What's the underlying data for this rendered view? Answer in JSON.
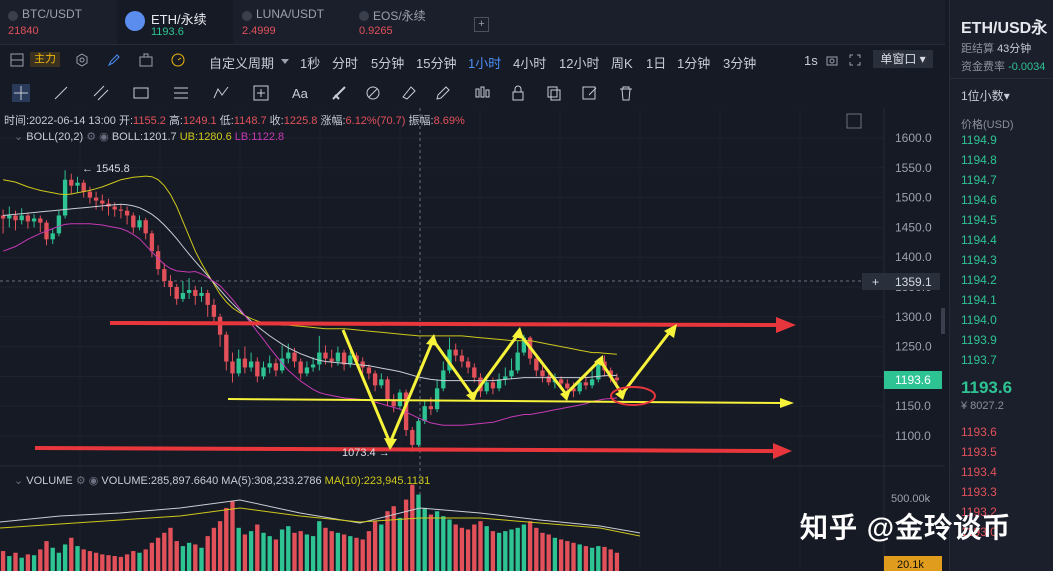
{
  "tabs": [
    {
      "name": "BTC/USDT",
      "price": "21840",
      "active": false
    },
    {
      "name": "ETH/永续",
      "price": "1193.6",
      "active": true
    },
    {
      "name": "LUNA/USDT",
      "price": "2.4999",
      "active": false
    },
    {
      "name": "EOS/永续",
      "price": "0.9265",
      "active": false
    }
  ],
  "add_tab": "+",
  "toolbar": {
    "main_label": "主力",
    "custom_period": "自定义周期",
    "periods": [
      "1秒",
      "分时",
      "5分钟",
      "15分钟",
      "1小时",
      "4小时",
      "12小时",
      "周K",
      "1日",
      "1分钟",
      "3分钟"
    ],
    "selected_period": "1小时",
    "right_1s": "1s",
    "single_window": "单窗口"
  },
  "drawing_tools": [
    "crosshair-icon",
    "line-icon",
    "parallel-line-icon",
    "rectangle-icon",
    "fib-icon",
    "pattern-icon",
    "measure-icon",
    "text-icon",
    "brush-icon",
    "ruler-icon",
    "eraser-icon",
    "pencil-icon",
    "candles-icon",
    "lock-icon",
    "copy-icon",
    "edit-icon",
    "trash-icon"
  ],
  "ohlc_bar": {
    "time_label": "时间:",
    "time": "2022-06-14 13:00",
    "open_label": "开:",
    "open": "1155.2",
    "high_label": "高:",
    "high": "1249.1",
    "low_label": "低:",
    "low": "1148.7",
    "close_label": "收:",
    "close": "1225.8",
    "change_label": "涨幅:",
    "change": "6.12%(70.7)",
    "amp_label": "振幅:",
    "amp": "8.69%"
  },
  "boll": {
    "label": "BOLL(20,2)",
    "boll_text": "BOLL:1201.7",
    "ub_text": "UB:1280.6",
    "lb_text": "LB:1122.8"
  },
  "volume": {
    "label": "VOLUME",
    "vol_text": "VOLUME:285,897.6640",
    "ma5_text": "MA(5):308,233.2786",
    "ma10_text": "MA(10):223,945.1131"
  },
  "price_axis": {
    "labels": [
      "1600.0",
      "1550.0",
      "1500.0",
      "1450.0",
      "1400.0",
      "1350.0",
      "1300.0",
      "1250.0",
      "1200.0",
      "1150.0",
      "1100.0"
    ]
  },
  "volume_axis": {
    "labels": [
      "500.00k"
    ]
  },
  "crosshair_price": "1359.1",
  "current_price_tag": "1193.6",
  "volume_tag": "20.1k",
  "annotations": {
    "high_label": "← 1545.8",
    "low_label": "1073.4 →"
  },
  "right_panel": {
    "title": "ETH/USD永",
    "settle_label": "距结算",
    "settle_value": "43分钟",
    "funding_label": "资金费率",
    "funding_value": "-0.0034",
    "decimals": "1位小数",
    "price_header": "价格(USD)",
    "asks": [
      "1194.9",
      "1194.8",
      "1194.7",
      "1194.6",
      "1194.5",
      "1194.4",
      "1194.3",
      "1194.2",
      "1194.1",
      "1194.0",
      "1193.9",
      "1193.7"
    ],
    "last_price": "1193.6",
    "last_price_fiat": "¥ 8027.2",
    "bids": [
      "1193.6",
      "1193.5",
      "1193.4",
      "1193.3",
      "1193.2",
      "1193.0"
    ]
  },
  "watermark": "知乎 @金玲谈币",
  "colors": {
    "bg": "#161a25",
    "up": "#2ec393",
    "down": "#e2515a",
    "accent": "#4c8ff5",
    "yellow": "#f7f23a",
    "red_line": "#e8373c",
    "ub": "#cfc81b",
    "mid": "#c9cdd6",
    "lb": "#c53ab5"
  },
  "chart_data": {
    "type": "candlestick",
    "interval": "1h",
    "ylim": [
      1060,
      1630
    ],
    "candles": [
      [
        1470,
        1465,
        1440,
        1480
      ],
      [
        1465,
        1470,
        1450,
        1485
      ],
      [
        1470,
        1462,
        1445,
        1478
      ],
      [
        1462,
        1470,
        1455,
        1482
      ],
      [
        1470,
        1460,
        1448,
        1475
      ],
      [
        1460,
        1465,
        1450,
        1472
      ],
      [
        1465,
        1458,
        1442,
        1470
      ],
      [
        1458,
        1430,
        1420,
        1462
      ],
      [
        1430,
        1440,
        1422,
        1448
      ],
      [
        1440,
        1470,
        1435,
        1478
      ],
      [
        1470,
        1530,
        1465,
        1545.8
      ],
      [
        1530,
        1520,
        1505,
        1540
      ],
      [
        1520,
        1525,
        1508,
        1535
      ],
      [
        1525,
        1510,
        1500,
        1530
      ],
      [
        1510,
        1500,
        1490,
        1518
      ],
      [
        1500,
        1495,
        1480,
        1510
      ],
      [
        1495,
        1490,
        1478,
        1505
      ],
      [
        1490,
        1485,
        1470,
        1498
      ],
      [
        1485,
        1480,
        1468,
        1492
      ],
      [
        1480,
        1478,
        1465,
        1488
      ],
      [
        1478,
        1470,
        1455,
        1485
      ],
      [
        1470,
        1450,
        1440,
        1475
      ],
      [
        1450,
        1462,
        1445,
        1470
      ],
      [
        1462,
        1440,
        1430,
        1466
      ],
      [
        1440,
        1410,
        1400,
        1445
      ],
      [
        1410,
        1380,
        1370,
        1420
      ],
      [
        1380,
        1360,
        1350,
        1390
      ],
      [
        1360,
        1350,
        1335,
        1370
      ],
      [
        1350,
        1330,
        1320,
        1355
      ],
      [
        1330,
        1340,
        1325,
        1360
      ],
      [
        1340,
        1345,
        1330,
        1365
      ],
      [
        1345,
        1335,
        1320,
        1352
      ],
      [
        1335,
        1340,
        1325,
        1350
      ],
      [
        1340,
        1320,
        1300,
        1345
      ],
      [
        1320,
        1300,
        1290,
        1330
      ],
      [
        1300,
        1270,
        1250,
        1305
      ],
      [
        1270,
        1225,
        1210,
        1275
      ],
      [
        1225,
        1205,
        1190,
        1240
      ],
      [
        1205,
        1230,
        1200,
        1245
      ],
      [
        1230,
        1215,
        1205,
        1250
      ],
      [
        1215,
        1225,
        1208,
        1240
      ],
      [
        1225,
        1200,
        1190,
        1232
      ],
      [
        1200,
        1215,
        1195,
        1225
      ],
      [
        1215,
        1222,
        1205,
        1235
      ],
      [
        1222,
        1210,
        1200,
        1230
      ],
      [
        1210,
        1230,
        1205,
        1252
      ],
      [
        1230,
        1240,
        1222,
        1255
      ],
      [
        1240,
        1225,
        1215,
        1248
      ],
      [
        1225,
        1205,
        1195,
        1230
      ],
      [
        1205,
        1215,
        1200,
        1225
      ],
      [
        1215,
        1220,
        1208,
        1232
      ],
      [
        1220,
        1240,
        1210,
        1268
      ],
      [
        1240,
        1230,
        1220,
        1252
      ],
      [
        1230,
        1225,
        1215,
        1245
      ],
      [
        1225,
        1240,
        1218,
        1250
      ],
      [
        1240,
        1220,
        1210,
        1245
      ],
      [
        1220,
        1235,
        1215,
        1242
      ],
      [
        1235,
        1225,
        1218,
        1240
      ],
      [
        1225,
        1215,
        1205,
        1232
      ],
      [
        1215,
        1205,
        1195,
        1220
      ],
      [
        1205,
        1185,
        1175,
        1210
      ],
      [
        1185,
        1195,
        1180,
        1205
      ],
      [
        1195,
        1160,
        1150,
        1200
      ],
      [
        1160,
        1150,
        1140,
        1170
      ],
      [
        1150,
        1173,
        1145,
        1178
      ],
      [
        1173,
        1110,
        1100,
        1178
      ],
      [
        1110,
        1085,
        1073.4,
        1115
      ],
      [
        1085,
        1125,
        1082,
        1130
      ],
      [
        1125,
        1150,
        1120,
        1160
      ],
      [
        1150,
        1145,
        1135,
        1165
      ],
      [
        1145,
        1180,
        1140,
        1195
      ],
      [
        1180,
        1210,
        1175,
        1225
      ],
      [
        1210,
        1245,
        1205,
        1265
      ],
      [
        1245,
        1235,
        1225,
        1255
      ],
      [
        1235,
        1225,
        1215,
        1245
      ],
      [
        1225,
        1215,
        1205,
        1232
      ],
      [
        1215,
        1198,
        1190,
        1222
      ],
      [
        1198,
        1175,
        1165,
        1205
      ],
      [
        1175,
        1190,
        1170,
        1200
      ],
      [
        1190,
        1180,
        1170,
        1198
      ],
      [
        1180,
        1195,
        1175,
        1205
      ],
      [
        1195,
        1200,
        1185,
        1215
      ],
      [
        1200,
        1210,
        1195,
        1230
      ],
      [
        1210,
        1240,
        1205,
        1260
      ],
      [
        1240,
        1265,
        1235,
        1270
      ],
      [
        1265,
        1230,
        1220,
        1268
      ],
      [
        1230,
        1210,
        1200,
        1235
      ],
      [
        1210,
        1200,
        1190,
        1218
      ],
      [
        1200,
        1190,
        1185,
        1208
      ],
      [
        1190,
        1195,
        1180,
        1205
      ],
      [
        1195,
        1188,
        1180,
        1200
      ],
      [
        1188,
        1180,
        1170,
        1195
      ],
      [
        1180,
        1175,
        1165,
        1190
      ],
      [
        1175,
        1190,
        1170,
        1198
      ],
      [
        1190,
        1185,
        1178,
        1200
      ],
      [
        1185,
        1195,
        1180,
        1210
      ],
      [
        1195,
        1225,
        1190,
        1230
      ],
      [
        1225,
        1210,
        1200,
        1235
      ],
      [
        1210,
        1198,
        1190,
        1215
      ],
      [
        1198,
        1193.6,
        1185,
        1205
      ]
    ],
    "boll_ub": [
      1530,
      1528,
      1526,
      1522,
      1518,
      1515,
      1512,
      1510,
      1508,
      1506,
      1505,
      1506,
      1508,
      1510,
      1512,
      1515,
      1518,
      1522,
      1526,
      1530,
      1532,
      1534,
      1535,
      1536,
      1535,
      1530,
      1520,
      1505,
      1485,
      1460,
      1435,
      1410,
      1390,
      1372,
      1355,
      1338,
      1325,
      1315,
      1308,
      1302,
      1297,
      1293,
      1290,
      1288,
      1287,
      1286,
      1286,
      1285,
      1284,
      1283,
      1282,
      1281,
      1280,
      1280,
      1280,
      1280,
      1279,
      1278,
      1277,
      1276,
      1275,
      1274,
      1273,
      1272,
      1271,
      1270,
      1269,
      1268,
      1268,
      1268,
      1268,
      1268,
      1268,
      1268,
      1268,
      1267,
      1266,
      1265,
      1264,
      1263,
      1262,
      1261,
      1260,
      1260,
      1260,
      1260,
      1258,
      1256,
      1254,
      1252,
      1250,
      1248,
      1246,
      1244,
      1242,
      1240,
      1240,
      1239,
      1238,
      1237
    ],
    "boll_mid": [
      1470,
      1471,
      1472,
      1473,
      1474,
      1475,
      1476,
      1477,
      1478,
      1479,
      1480,
      1481,
      1482,
      1483,
      1484,
      1485,
      1486,
      1487,
      1488,
      1489,
      1488,
      1486,
      1483,
      1478,
      1472,
      1464,
      1454,
      1443,
      1431,
      1418,
      1405,
      1393,
      1381,
      1369,
      1357,
      1345,
      1333,
      1322,
      1312,
      1302,
      1293,
      1284,
      1276,
      1268,
      1261,
      1254,
      1248,
      1243,
      1238,
      1234,
      1230,
      1227,
      1225,
      1224,
      1223,
      1222,
      1221,
      1220,
      1219,
      1218,
      1216,
      1214,
      1212,
      1210,
      1208,
      1205,
      1202,
      1199,
      1197,
      1195,
      1194,
      1193,
      1193,
      1193,
      1193,
      1193,
      1193,
      1193,
      1193,
      1193,
      1194,
      1195,
      1196,
      1197,
      1198,
      1198,
      1198,
      1198,
      1198,
      1198,
      1198,
      1198,
      1198,
      1198,
      1198,
      1199,
      1200,
      1201,
      1201.5,
      1201.7
    ],
    "boll_lb": [
      1410,
      1414,
      1418,
      1424,
      1430,
      1435,
      1440,
      1444,
      1448,
      1452,
      1455,
      1456,
      1456,
      1456,
      1456,
      1455,
      1454,
      1452,
      1450,
      1448,
      1444,
      1438,
      1431,
      1420,
      1409,
      1398,
      1388,
      1381,
      1377,
      1376,
      1375,
      1376,
      1372,
      1366,
      1359,
      1352,
      1341,
      1329,
      1316,
      1302,
      1289,
      1275,
      1262,
      1248,
      1235,
      1222,
      1210,
      1201,
      1192,
      1185,
      1178,
      1173,
      1170,
      1168,
      1166,
      1164,
      1163,
      1162,
      1161,
      1160,
      1157,
      1154,
      1151,
      1148,
      1145,
      1140,
      1135,
      1130,
      1126,
      1122,
      1120,
      1118,
      1118,
      1118,
      1118,
      1119,
      1120,
      1121,
      1122,
      1123,
      1126,
      1129,
      1132,
      1134,
      1136,
      1136,
      1138,
      1140,
      1142,
      1144,
      1146,
      1148,
      1150,
      1152,
      1154,
      1158,
      1160,
      1162,
      1163,
      1164
    ],
    "volume": [
      120,
      90,
      110,
      80,
      100,
      95,
      130,
      180,
      140,
      110,
      160,
      200,
      150,
      130,
      120,
      110,
      100,
      95,
      90,
      85,
      100,
      120,
      110,
      130,
      170,
      200,
      230,
      260,
      180,
      150,
      170,
      160,
      140,
      210,
      260,
      300,
      380,
      420,
      260,
      220,
      240,
      280,
      230,
      210,
      190,
      250,
      270,
      230,
      240,
      220,
      210,
      300,
      260,
      240,
      230,
      220,
      210,
      200,
      190,
      240,
      300,
      280,
      360,
      390,
      320,
      430,
      520,
      460,
      380,
      340,
      360,
      330,
      310,
      280,
      260,
      250,
      280,
      300,
      270,
      240,
      230,
      240,
      250,
      260,
      280,
      300,
      260,
      230,
      220,
      200,
      190,
      180,
      170,
      160,
      150,
      140,
      150,
      145,
      130,
      110
    ],
    "volume_ylim": [
      0,
      560
    ],
    "annotations": [
      {
        "type": "hline",
        "color": "red",
        "y": 1285,
        "from": 20,
        "to": "right-arrow"
      },
      {
        "type": "hline",
        "color": "yellow",
        "y": 1155,
        "from": 20,
        "to": "right-arrow"
      },
      {
        "type": "hline",
        "color": "red",
        "y": 1075,
        "from": 0,
        "to": "right-arrow"
      }
    ]
  }
}
